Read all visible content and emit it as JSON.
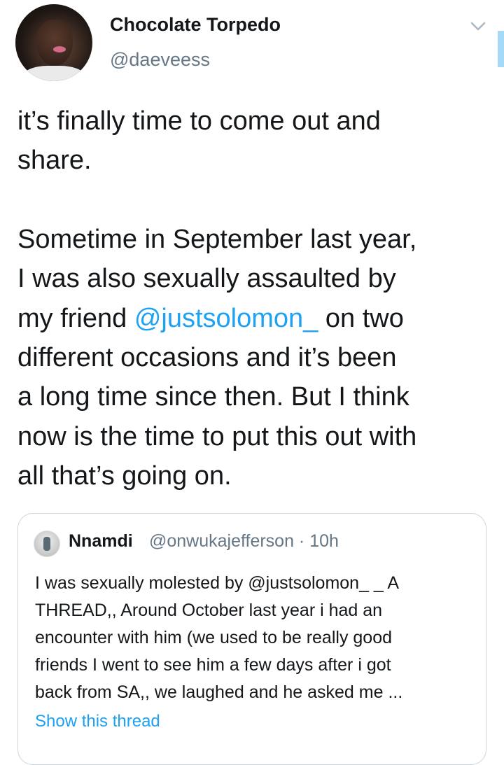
{
  "author": {
    "display_name": "Chocolate Torpedo",
    "handle": "@daeveess",
    "avatar_icon": "profile-photo"
  },
  "tweet": {
    "para1": [
      "it’s finally time to come out and",
      "share."
    ],
    "para2_lines": [
      "Sometime in September last year,",
      "I was also sexually assaulted by"
    ],
    "para2_mention_line": {
      "before": "my friend ",
      "mention": "@justsolomon_",
      "after": "  on two"
    },
    "para2_rest": [
      "different occasions and it’s been",
      "a long time since then. But I think",
      "now is the time to put this out with",
      "all that’s going on."
    ]
  },
  "quoted_tweet": {
    "name": "Nnamdi",
    "meta": "@onwukajefferson · 10h",
    "lines": [
      "I was sexually molested by @justsolomon_ _ A",
      "THREAD,, Around October last year i had an",
      "encounter with him (we used to be really good",
      "friends I went to see him a few days  after i got",
      "back from SA,,  we laughed and he asked me ..."
    ],
    "show_thread": "Show this thread"
  },
  "colors": {
    "accent": "#1da1f2",
    "muted": "#657786",
    "border": "#ccd6dd"
  }
}
